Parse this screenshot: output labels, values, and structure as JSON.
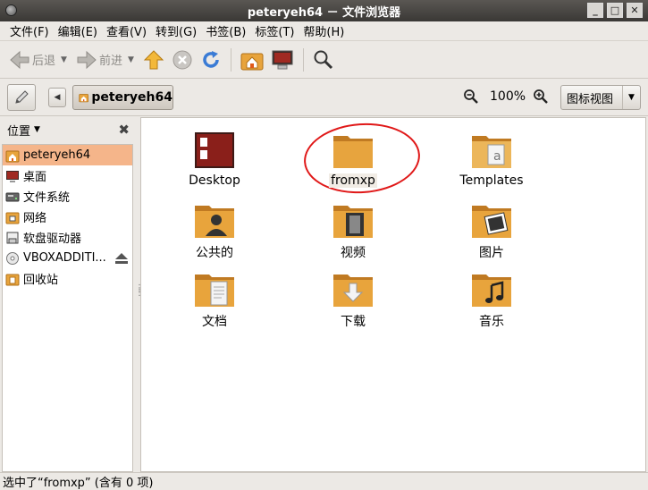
{
  "window": {
    "title": "peteryeh64 － 文件浏览器",
    "buttons": [
      "_",
      "□",
      "✕"
    ]
  },
  "menu": [
    "文件(F)",
    "编辑(E)",
    "查看(V)",
    "转到(G)",
    "书签(B)",
    "标签(T)",
    "帮助(H)"
  ],
  "toolbar": {
    "back_label": "后退",
    "forward_label": "前进"
  },
  "location": {
    "path_button": "peteryeh64",
    "zoom": "100%",
    "view_mode": "图标视图"
  },
  "sidebar": {
    "header": "位置",
    "items": [
      {
        "label": "peteryeh64",
        "icon": "home-folder-icon"
      },
      {
        "label": "桌面",
        "icon": "desktop-icon"
      },
      {
        "label": "文件系统",
        "icon": "filesystem-icon"
      },
      {
        "label": "网络",
        "icon": "network-icon"
      },
      {
        "label": "软盘驱动器",
        "icon": "floppy-icon"
      },
      {
        "label": "VBOXADDITI...",
        "icon": "cdrom-icon"
      },
      {
        "label": "回收站",
        "icon": "trash-icon"
      }
    ]
  },
  "files": [
    {
      "label": "Desktop",
      "icon": "desktop-folder-icon"
    },
    {
      "label": "fromxp",
      "icon": "folder-icon"
    },
    {
      "label": "Templates",
      "icon": "templates-folder-icon"
    },
    {
      "label": "公共的",
      "icon": "public-folder-icon"
    },
    {
      "label": "视频",
      "icon": "videos-folder-icon"
    },
    {
      "label": "图片",
      "icon": "pictures-folder-icon"
    },
    {
      "label": "文档",
      "icon": "documents-folder-icon"
    },
    {
      "label": "下载",
      "icon": "downloads-folder-icon"
    },
    {
      "label": "音乐",
      "icon": "music-folder-icon"
    }
  ],
  "status": "选中了“fromxp” (含有 0 项)",
  "colors": {
    "selection": "#f5b58a",
    "folder": "#e8a43c",
    "annotation": "#e01818"
  }
}
